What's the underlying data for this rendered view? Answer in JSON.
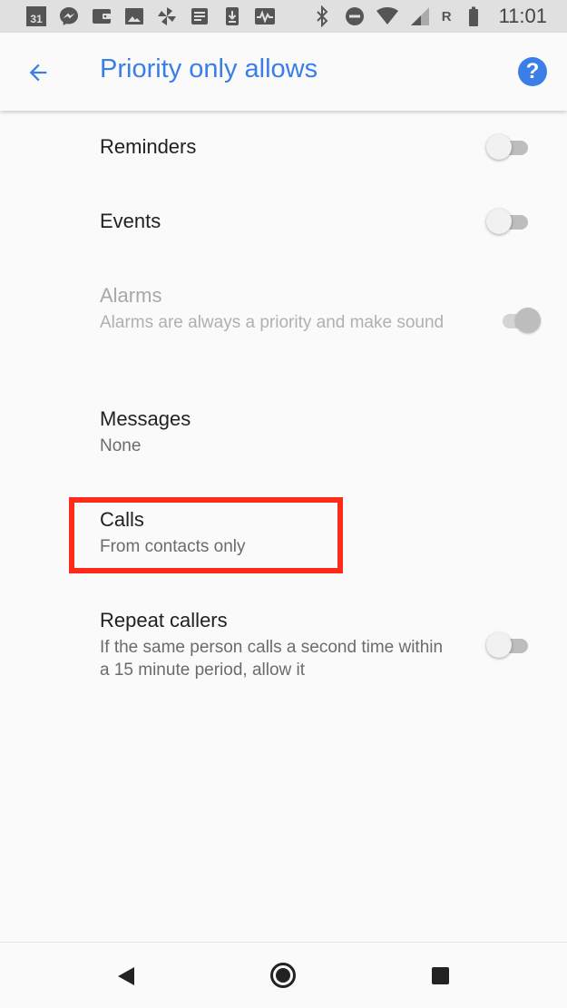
{
  "status_bar": {
    "calendar_day": "31",
    "icons_left": [
      "calendar-icon",
      "messenger-icon",
      "wallet-icon",
      "image-icon",
      "pinwheel-icon",
      "docs-icon",
      "download-icon",
      "pulse-icon"
    ],
    "icons_right": [
      "bluetooth-icon",
      "do-not-disturb-icon",
      "wifi-icon",
      "signal-icon",
      "battery-icon"
    ],
    "roaming": "R",
    "time": "11:01"
  },
  "app_bar": {
    "title": "Priority only allows",
    "help_glyph": "?",
    "accent": "#3a7ee8"
  },
  "settings": [
    {
      "id": "reminders",
      "title": "Reminders",
      "subtitle": "",
      "toggle": "off",
      "enabled": true
    },
    {
      "id": "events",
      "title": "Events",
      "subtitle": "",
      "toggle": "off",
      "enabled": true
    },
    {
      "id": "alarms",
      "title": "Alarms",
      "subtitle": "Alarms are always a priority and make sound",
      "toggle": "on",
      "enabled": false
    },
    {
      "id": "messages",
      "title": "Messages",
      "subtitle": "None",
      "toggle": null,
      "enabled": true
    },
    {
      "id": "calls",
      "title": "Calls",
      "subtitle": "From contacts only",
      "toggle": null,
      "enabled": true
    },
    {
      "id": "repeat_callers",
      "title": "Repeat callers",
      "subtitle": "If the same person calls a second time within a 15 minute period, allow it",
      "toggle": "off",
      "enabled": true
    }
  ],
  "highlight": {
    "target": "calls",
    "color": "#ff2a1a"
  },
  "nav_bar": {
    "icons": [
      "nav-back-icon",
      "nav-home-icon",
      "nav-recents-icon"
    ]
  }
}
